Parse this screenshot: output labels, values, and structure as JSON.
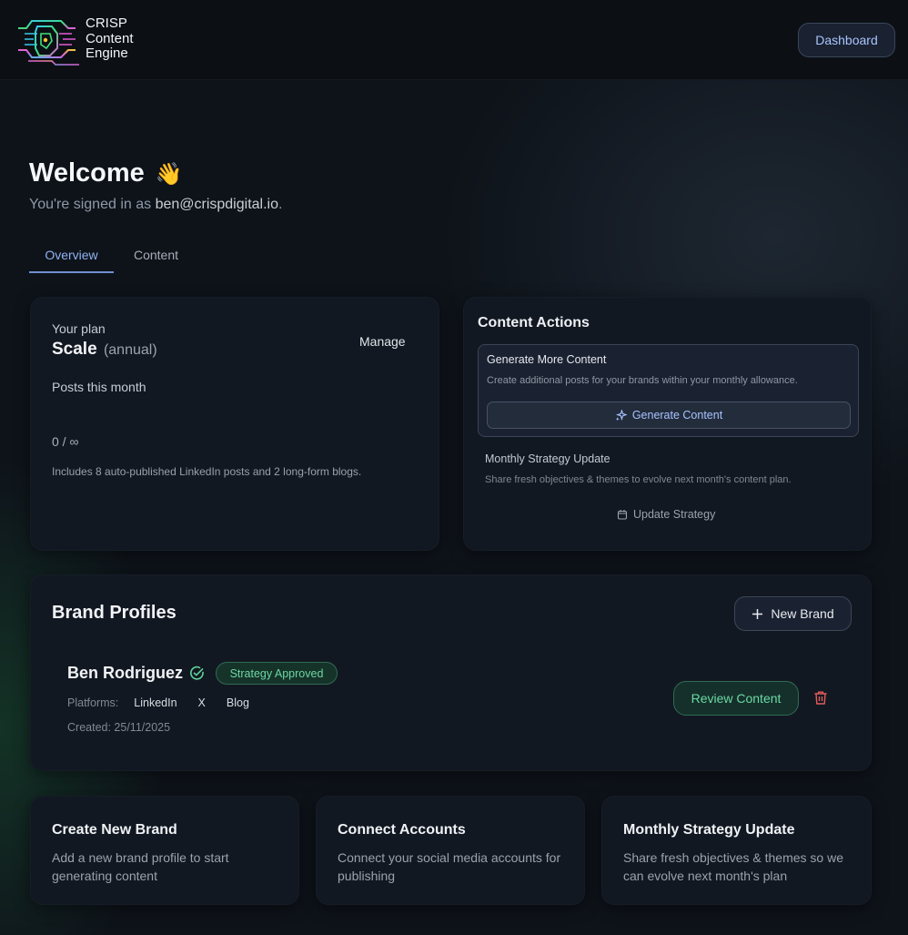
{
  "header": {
    "logo_lines": [
      "CRISP",
      "Content",
      "Engine"
    ],
    "dashboard_label": "Dashboard"
  },
  "welcome": {
    "title": "Welcome",
    "emoji": "👋",
    "signed_prefix": "You're signed in as ",
    "email": "ben@crispdigital.io",
    "signed_suffix": "."
  },
  "tabs": [
    {
      "label": "Overview",
      "active": true
    },
    {
      "label": "Content",
      "active": false
    }
  ],
  "plan": {
    "label": "Your plan",
    "name": "Scale",
    "period": "(annual)",
    "manage_label": "Manage",
    "posts_label": "Posts this month",
    "posts_count": "0 / ∞",
    "includes": "Includes 8 auto-published LinkedIn posts and 2 long-form blogs."
  },
  "actions": {
    "title": "Content Actions",
    "generate": {
      "title": "Generate More Content",
      "description": "Create additional posts for your brands within your monthly allowance.",
      "button_label": "Generate Content"
    },
    "strategy": {
      "title": "Monthly Strategy Update",
      "description": "Share fresh objectives & themes to evolve next month's content plan.",
      "button_label": "Update Strategy"
    }
  },
  "brands": {
    "title": "Brand Profiles",
    "new_brand_label": "New Brand",
    "items": [
      {
        "name": "Ben Rodriguez",
        "status": "Strategy Approved",
        "platforms_label": "Platforms:",
        "platforms": [
          "LinkedIn",
          "X",
          "Blog"
        ],
        "created": "Created: 25/11/2025",
        "review_label": "Review Content"
      }
    ]
  },
  "quick_cards": [
    {
      "title": "Create New Brand",
      "description": "Add a new brand profile to start generating content"
    },
    {
      "title": "Connect Accounts",
      "description": "Connect your social media accounts for publishing"
    },
    {
      "title": "Monthly Strategy Update",
      "description": "Share fresh objectives & themes so we can evolve next month's plan"
    }
  ],
  "colors": {
    "accent_blue": "#a6c2ff",
    "success_green": "#69d6a3",
    "danger_red": "#e05c5c"
  }
}
